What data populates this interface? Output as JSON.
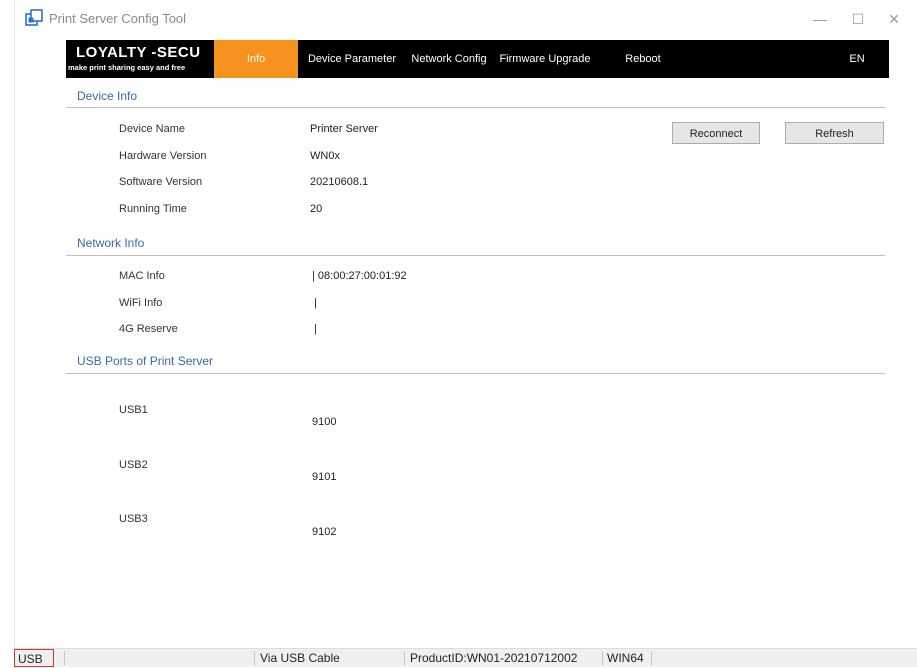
{
  "window": {
    "title": "Print Server Config Tool",
    "minimize": "—",
    "maximize": "☐",
    "close": "✕"
  },
  "logo": {
    "main": "LOYALTY -SECU",
    "sub": "make print sharing easy and free"
  },
  "nav": {
    "items": [
      {
        "label": "Info",
        "active": true
      },
      {
        "label": "Device Parameter"
      },
      {
        "label": "Network Config"
      },
      {
        "label": "Firmware Upgrade"
      },
      {
        "label": "Reboot"
      }
    ],
    "language": "EN"
  },
  "device_info": {
    "title": "Device Info",
    "rows": [
      {
        "label": "Device Name",
        "value": "Printer Server"
      },
      {
        "label": "Hardware Version",
        "value": "WN0x"
      },
      {
        "label": "Software Version",
        "value": "20210608.1"
      },
      {
        "label": "Running Time",
        "value": "20"
      }
    ],
    "reconnect_label": "Reconnect",
    "refresh_label": "Refresh"
  },
  "network_info": {
    "title": "Network Info",
    "rows": [
      {
        "label": "MAC Info",
        "value": "| 08:00:27:00:01:92"
      },
      {
        "label": "WiFi Info",
        "value": "|"
      },
      {
        "label": "4G Reserve",
        "value": "|"
      }
    ]
  },
  "usb_ports": {
    "title": "USB Ports of Print Server",
    "ports": [
      {
        "name": "USB1",
        "port": "9100"
      },
      {
        "name": "USB2",
        "port": "9101"
      },
      {
        "name": "USB3",
        "port": "9102"
      }
    ]
  },
  "statusbar": {
    "connection": "USB",
    "mode": "Via USB Cable",
    "product_id": "ProductID:WN01-20210712002",
    "platform": "WIN64"
  },
  "colors": {
    "accent": "#f7921e",
    "section_title": "#3b67a8",
    "navbar": "#000000",
    "usb_highlight_border": "#e03030"
  }
}
